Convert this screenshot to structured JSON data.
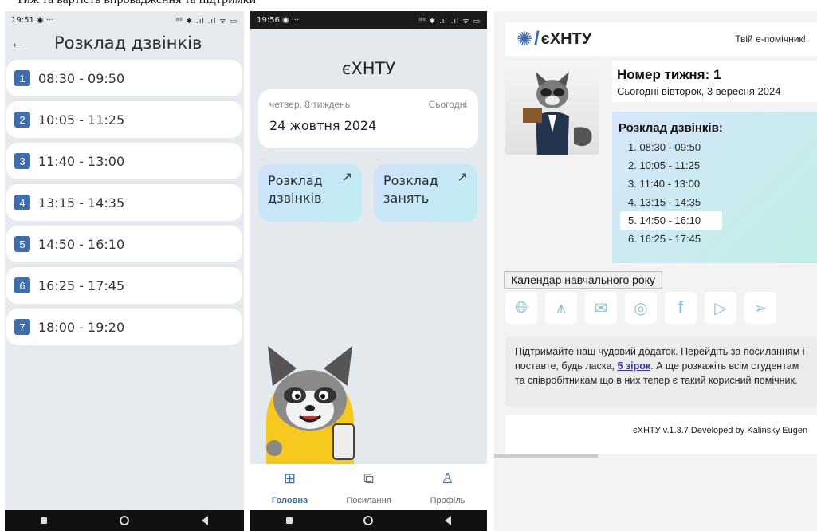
{
  "caption": "Тиж та вартість впровадження та підтримки",
  "phone1": {
    "status": {
      "time": "19:51",
      "icons": "◉ ···",
      "right": "⁰⁰ ✱ .ıl .ıl ᯤ ▭"
    },
    "title": "Розклад дзвінків",
    "bells": [
      {
        "num": "1",
        "time": "08:30 - 09:50"
      },
      {
        "num": "2",
        "time": "10:05 - 11:25"
      },
      {
        "num": "3",
        "time": "11:40 - 13:00"
      },
      {
        "num": "4",
        "time": "13:15 - 14:35"
      },
      {
        "num": "5",
        "time": "14:50 - 16:10"
      },
      {
        "num": "6",
        "time": "16:25 - 17:45"
      },
      {
        "num": "7",
        "time": "18:00 - 19:20"
      }
    ]
  },
  "phone2": {
    "status": {
      "time": "19:56",
      "icons": "◉ ···",
      "right": "⁰⁰ ✱ .ıl .ıl ᯤ ▭"
    },
    "app_title": "єХНТУ",
    "date_card": {
      "weekday": "четвер, 8 тиждень",
      "today": "Сьогодні",
      "date": "24 жовтня 2024"
    },
    "tiles": [
      {
        "label": "Розклад дзвінків"
      },
      {
        "label": "Розклад занять"
      }
    ],
    "tabs": [
      {
        "label": "Головна"
      },
      {
        "label": "Посилання"
      },
      {
        "label": "Профіль"
      }
    ]
  },
  "web": {
    "logo": "єХНТУ",
    "helper": "Твій е-помічник!",
    "week_title": "Номер тижня: 1",
    "week_sub": "Сьогодні вівторок, 3 вересня 2024",
    "bells_title": "Розклад дзвінків:",
    "bells": [
      "1. 08:30 - 09:50",
      "2. 10:05 - 11:25",
      "3. 11:40 - 13:00",
      "4. 13:15 - 14:35",
      "5. 14:50 - 16:10",
      "6. 16:25 - 17:45"
    ],
    "calendar_button": "Календар навчального року",
    "support_before": "Підтримайте наш чудовий додаток. Перейдіть за посиланням і поставте, будь ласка, ",
    "support_link": "5 зірок",
    "support_after": ". А ще розкажіть всім студентам та співробітникам що в них тепер є такий корисний помічник.",
    "footer": "єХНТУ v.1.3.7  Developed by Kalinsky Eugen"
  },
  "colors": {
    "accent": "#3d6dad",
    "social": "#8fc3d8"
  }
}
